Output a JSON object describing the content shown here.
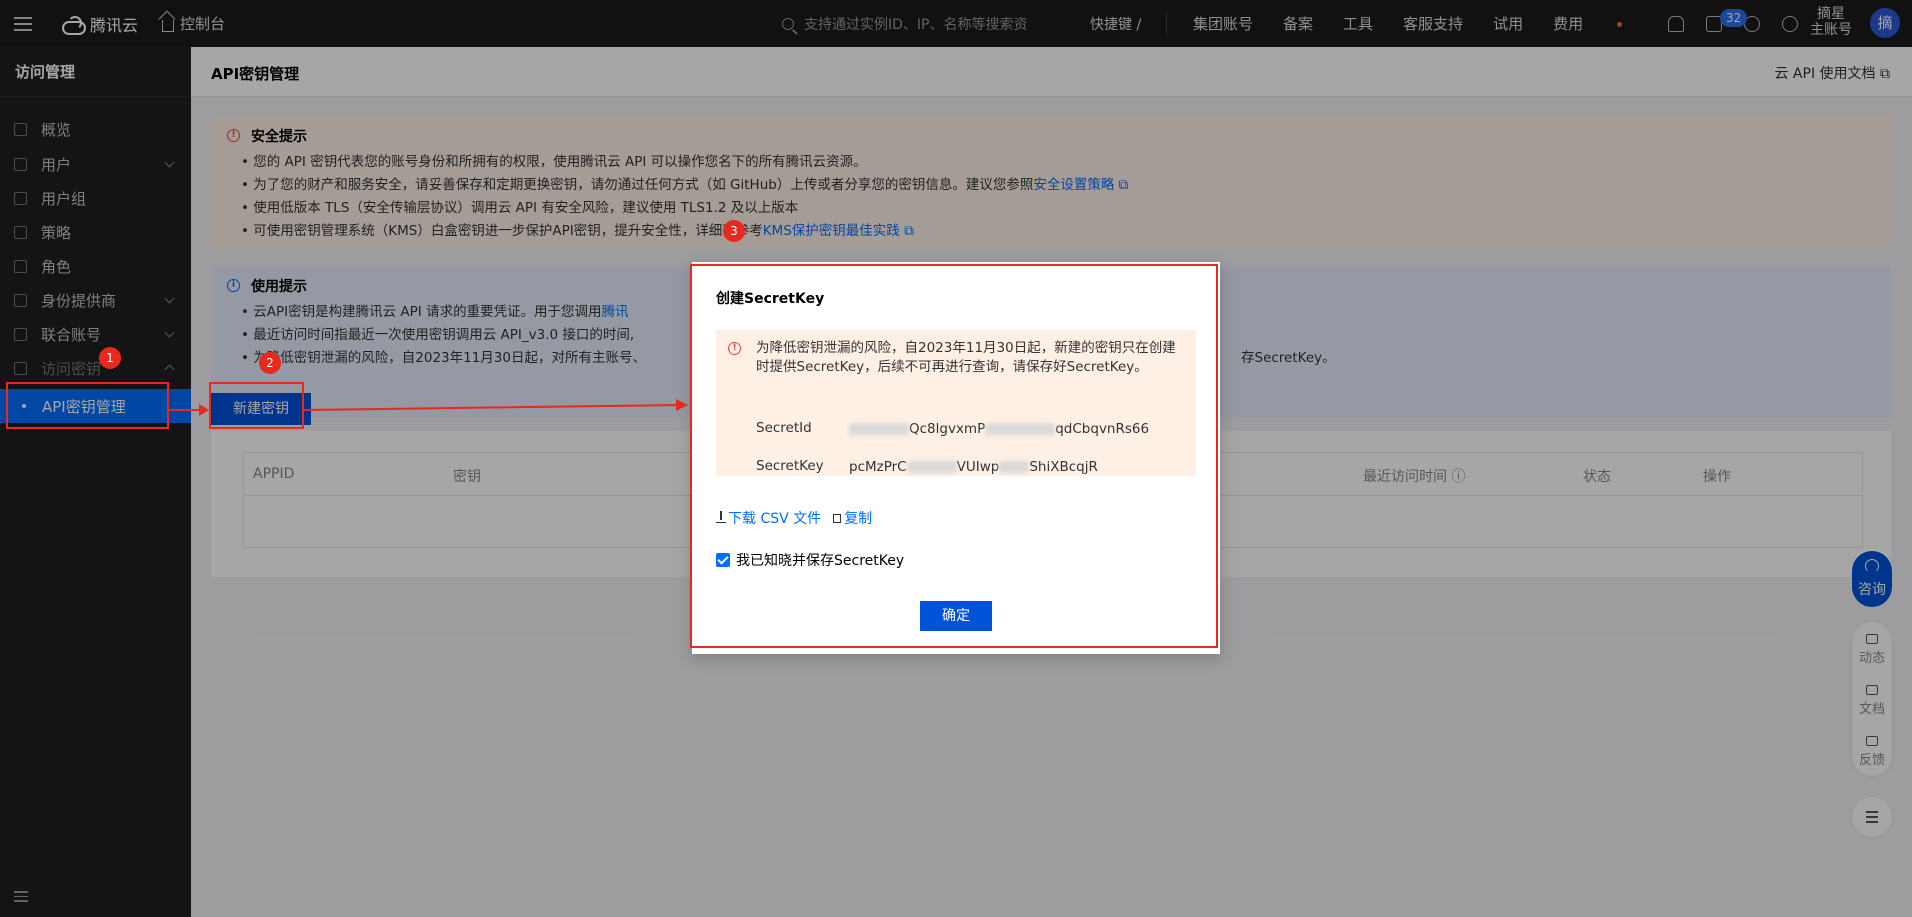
{
  "topbar": {
    "brand": "腾讯云",
    "console": "控制台",
    "search_placeholder": "支持通过实例ID、IP、名称等搜索资",
    "shortcut": "快捷键 /",
    "nav": [
      "集团账号",
      "备案",
      "工具",
      "客服支持",
      "试用",
      "费用"
    ],
    "notification_count": "32",
    "account_line1": "摘星",
    "account_line2": "主账号",
    "avatar_text": "摘"
  },
  "sidebar": {
    "title": "访问管理",
    "items": [
      {
        "label": "概览"
      },
      {
        "label": "用户"
      },
      {
        "label": "用户组"
      },
      {
        "label": "策略"
      },
      {
        "label": "角色"
      },
      {
        "label": "身份提供商"
      },
      {
        "label": "联合账号"
      },
      {
        "label": "访问密钥"
      },
      {
        "label": "API密钥管理"
      }
    ]
  },
  "page": {
    "title": "API密钥管理",
    "doc_link": "云 API 使用文档"
  },
  "security_tip": {
    "title": "安全提示",
    "lines": [
      "您的 API 密钥代表您的账号身份和所拥有的权限，使用腾讯云 API 可以操作您名下的所有腾讯云资源。",
      "为了您的财产和服务安全，请妥善保存和定期更换密钥，请勿通过任何方式（如 GitHub）上传或者分享您的密钥信息。建议您参照",
      "使用低版本 TLS（安全传输层协议）调用云 API 有安全风险，建议使用 TLS1.2 及以上版本",
      "可使用密钥管理系统（KMS）白盒密钥进一步保护API密钥，提升安全性，详细可参考"
    ],
    "link1": "安全设置策略",
    "link2": "KMS保护密钥最佳实践"
  },
  "usage_tip": {
    "title": "使用提示",
    "lines": [
      "云API密钥是构建腾讯云 API 请求的重要凭证。用于您调用",
      "最近访问时间指最近一次使用密钥调用云 API_v3.0 接口的时间,",
      "为降低密钥泄漏的风险，自2023年11月30日起，对所有主账号、"
    ],
    "link": "腾讯",
    "line3_tail": "存SecretKey。"
  },
  "new_key_button": "新建密钥",
  "table": {
    "columns": [
      "APPID",
      "密钥",
      "最近访问时间",
      "状态",
      "操作"
    ]
  },
  "float": {
    "consult": "咨询",
    "tools": [
      "动态",
      "文档",
      "反馈"
    ]
  },
  "modal": {
    "title": "创建SecretKey",
    "warning": "为降低密钥泄漏的风险，自2023年11月30日起，新建的密钥只在创建时提供SecretKey，后续不可再进行查询，请保存好SecretKey。",
    "secret_id_label": "SecretId",
    "secret_id_visible": "Qc8lgvxmP",
    "secret_id_tail": "qdCbqvnRs66",
    "secret_key_label": "SecretKey",
    "secret_key_head": "pcMzPrC",
    "secret_key_mid": "VUIwp",
    "secret_key_tail": "ShiXBcqjR",
    "download_csv": "下载 CSV 文件",
    "copy": "复制",
    "ack": "我已知晓并保存SecretKey",
    "confirm": "确定"
  },
  "annotations": [
    "1",
    "2",
    "3"
  ],
  "colors": {
    "primary": "#0052d9",
    "annotation_red": "#e8291f",
    "warn_bg": "#fff0e6",
    "info_bg": "#e5ecfa"
  }
}
